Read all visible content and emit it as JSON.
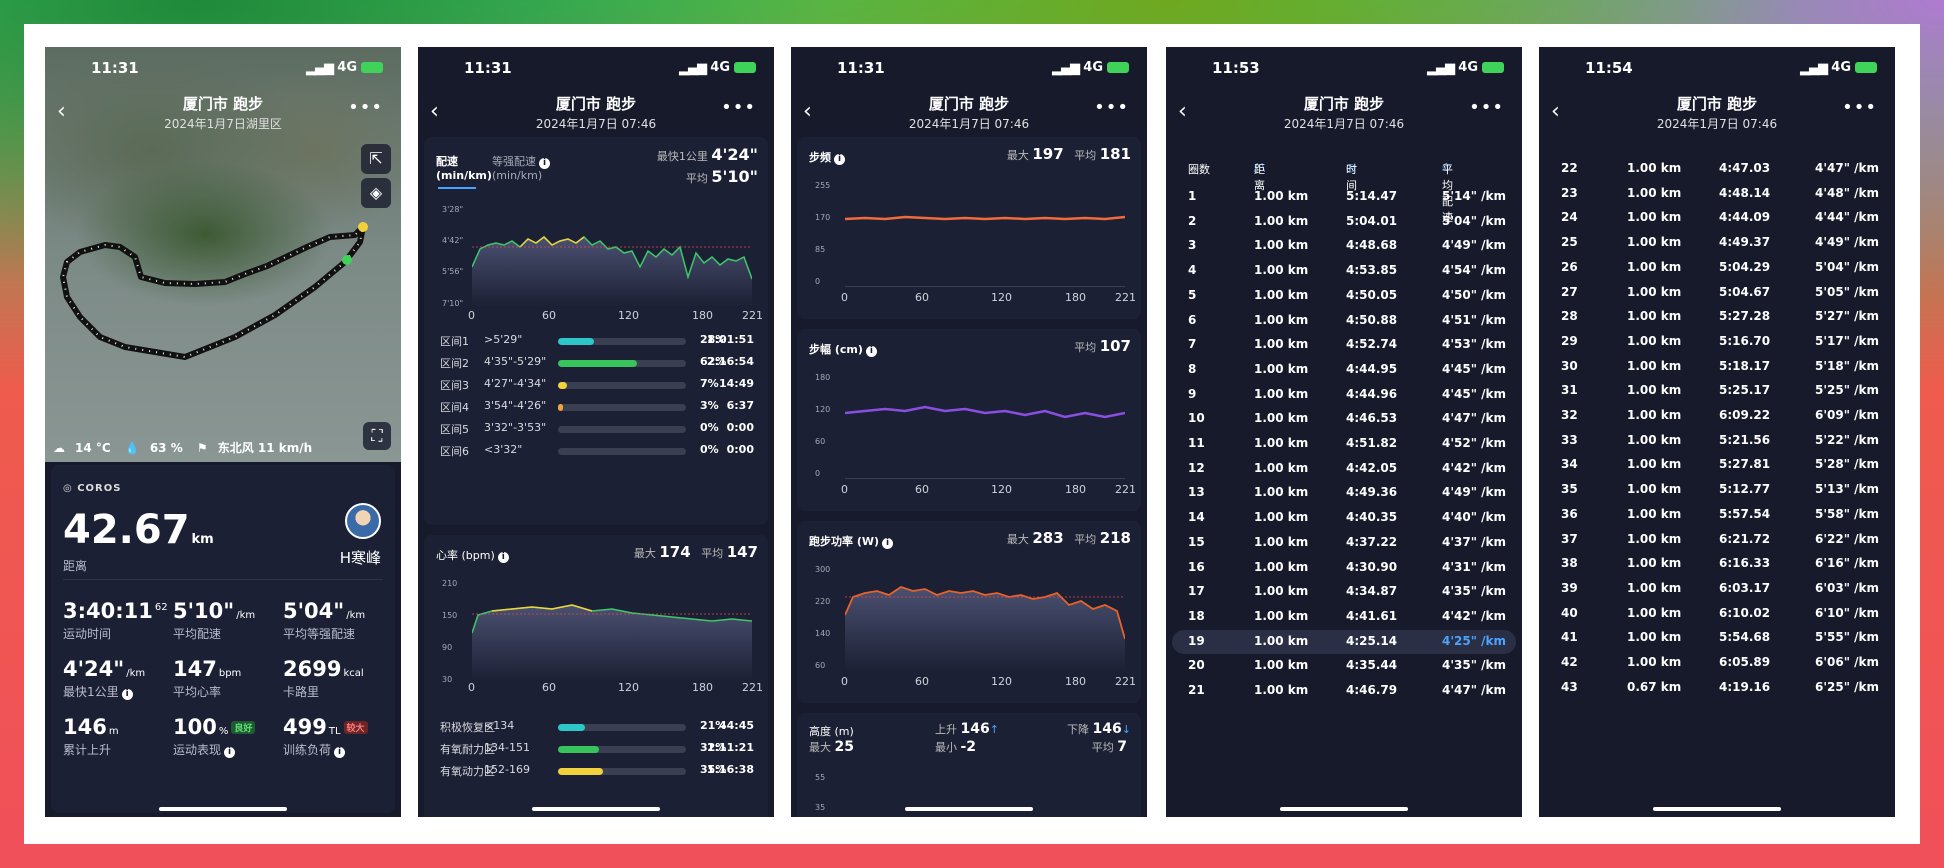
{
  "status": {
    "signal": "4G"
  },
  "nav": {
    "title": "厦门市 跑步",
    "subtitle": "2024年1月7日 07:46",
    "map_subtitle": "2024年1月7日湖里区"
  },
  "phones": {
    "map": {
      "time": "11:31",
      "weather": {
        "temp": "14 °C",
        "humidity": "63 %",
        "wind": "东北风 11 km/h"
      },
      "brand": "COROS",
      "distance": "42.67",
      "distance_unit": "km",
      "distance_label": "距离",
      "user": "H寒峰",
      "stats": [
        {
          "value": "3:40:11",
          "sup": "62",
          "label": "运动时间"
        },
        {
          "value": "5'10\"",
          "sup": "/km",
          "label": "平均配速"
        },
        {
          "value": "5'04\"",
          "sup": "/km",
          "label": "平均等强配速"
        },
        {
          "value": "4'24\"",
          "sup": "/km",
          "label": "最快1公里"
        },
        {
          "value": "147",
          "sup": "bpm",
          "label": "平均心率"
        },
        {
          "value": "2699",
          "sup": "kcal",
          "label": "卡路里"
        },
        {
          "value": "146",
          "sup": "m",
          "label": "累计上升"
        },
        {
          "value": "100",
          "sup": "%",
          "label": "运动表现",
          "tag": "良好"
        },
        {
          "value": "499",
          "sup": "TL",
          "label": "训练负荷",
          "tag": "较大"
        }
      ]
    },
    "pace": {
      "time": "11:31",
      "tab_pace": "配速",
      "tab_pace_unit": "(min/km)",
      "tab_gap": "等强配速",
      "tab_gap_unit": "(min/km)",
      "fastest_label": "最快1公里",
      "fastest": "4'24\"",
      "avg_label": "平均",
      "avg": "5'10\"",
      "y_ticks": [
        "3'28\"",
        "4'42\"",
        "5'56\"",
        "7'10\""
      ],
      "x_ticks": [
        "0",
        "60",
        "120",
        "180",
        "221"
      ],
      "zones": [
        {
          "name": "区间1",
          "range": ">5'29\"",
          "pct": "28%",
          "time": "1:01:51",
          "frac": 0.28,
          "color": "#2ec7c9"
        },
        {
          "name": "区间2",
          "range": "4'35\"-5'29\"",
          "pct": "62%",
          "time": "2:16:54",
          "frac": 0.62,
          "color": "#37c45a"
        },
        {
          "name": "区间3",
          "range": "4'27\"-4'34\"",
          "pct": "7%",
          "time": "14:49",
          "frac": 0.07,
          "color": "#f2d23c"
        },
        {
          "name": "区间4",
          "range": "3'54\"-4'26\"",
          "pct": "3%",
          "time": "6:37",
          "frac": 0.03,
          "color": "#f2a33c"
        },
        {
          "name": "区间5",
          "range": "3'32\"-3'53\"",
          "pct": "0%",
          "time": "0:00",
          "frac": 0,
          "color": "#f06a3c"
        },
        {
          "name": "区间6",
          "range": "<3'32\"",
          "pct": "0%",
          "time": "0:00",
          "frac": 0,
          "color": "#e03c3c"
        }
      ],
      "hr_title": "心率 (bpm)",
      "hr_max_label": "最大",
      "hr_max": "174",
      "hr_avg_label": "平均",
      "hr_avg": "147",
      "hr_y_ticks": [
        "210",
        "150",
        "90",
        "30"
      ],
      "hr_zones": [
        {
          "name": "积极恢复区",
          "range": "<134",
          "pct": "21%",
          "time": "44:45",
          "frac": 0.21,
          "color": "#2ec7c9"
        },
        {
          "name": "有氧耐力区",
          "range": "134-151",
          "pct": "32%",
          "time": "1:11:21",
          "frac": 0.32,
          "color": "#37c45a"
        },
        {
          "name": "有氧动力区",
          "range": "152-169",
          "pct": "35%",
          "time": "1:16:38",
          "frac": 0.35,
          "color": "#f2d23c"
        }
      ]
    },
    "dynamics": {
      "time": "11:31",
      "cadence_title": "步频",
      "cadence_max_label": "最大",
      "cadence_max": "197",
      "cadence_avg_label": "平均",
      "cadence_avg": "181",
      "cadence_y": [
        "255",
        "170",
        "85",
        "0"
      ],
      "stride_title": "步幅 (cm)",
      "stride_avg_label": "平均",
      "stride_avg": "107",
      "stride_y": [
        "180",
        "120",
        "60",
        "0"
      ],
      "power_title": "跑步功率 (W)",
      "power_max_label": "最大",
      "power_max": "283",
      "power_avg_label": "平均",
      "power_avg": "218",
      "power_y": [
        "300",
        "220",
        "140",
        "60"
      ],
      "x_ticks": [
        "0",
        "60",
        "120",
        "180",
        "221"
      ],
      "elev_title": "高度 (m)",
      "elev_up_label": "上升",
      "elev_up": "146",
      "elev_down_label": "下降",
      "elev_down": "146",
      "elev_max_label": "最大",
      "elev_max": "25",
      "elev_min_label": "最小",
      "elev_min": "-2",
      "elev_avg_label": "平均",
      "elev_avg": "7",
      "elev_y": [
        "55",
        "35"
      ]
    },
    "splits1": {
      "time": "11:53",
      "headers": [
        "圈数",
        "距离",
        "时间",
        "平均配速"
      ],
      "rows": [
        [
          "1",
          "1.00 km",
          "5:14.47",
          "5'14\" /km"
        ],
        [
          "2",
          "1.00 km",
          "5:04.01",
          "5'04\" /km"
        ],
        [
          "3",
          "1.00 km",
          "4:48.68",
          "4'49\" /km"
        ],
        [
          "4",
          "1.00 km",
          "4:53.85",
          "4'54\" /km"
        ],
        [
          "5",
          "1.00 km",
          "4:50.05",
          "4'50\" /km"
        ],
        [
          "6",
          "1.00 km",
          "4:50.88",
          "4'51\" /km"
        ],
        [
          "7",
          "1.00 km",
          "4:52.74",
          "4'53\" /km"
        ],
        [
          "8",
          "1.00 km",
          "4:44.95",
          "4'45\" /km"
        ],
        [
          "9",
          "1.00 km",
          "4:44.96",
          "4'45\" /km"
        ],
        [
          "10",
          "1.00 km",
          "4:46.53",
          "4'47\" /km"
        ],
        [
          "11",
          "1.00 km",
          "4:51.82",
          "4'52\" /km"
        ],
        [
          "12",
          "1.00 km",
          "4:42.05",
          "4'42\" /km"
        ],
        [
          "13",
          "1.00 km",
          "4:49.36",
          "4'49\" /km"
        ],
        [
          "14",
          "1.00 km",
          "4:40.35",
          "4'40\" /km"
        ],
        [
          "15",
          "1.00 km",
          "4:37.22",
          "4'37\" /km"
        ],
        [
          "16",
          "1.00 km",
          "4:30.90",
          "4'31\" /km"
        ],
        [
          "17",
          "1.00 km",
          "4:34.87",
          "4'35\" /km"
        ],
        [
          "18",
          "1.00 km",
          "4:41.61",
          "4'42\" /km"
        ],
        [
          "19",
          "1.00 km",
          "4:25.14",
          "4'25\" /km"
        ],
        [
          "20",
          "1.00 km",
          "4:35.44",
          "4'35\" /km"
        ],
        [
          "21",
          "1.00 km",
          "4:46.79",
          "4'47\" /km"
        ]
      ],
      "highlight_index": 18
    },
    "splits2": {
      "time": "11:54",
      "rows": [
        [
          "22",
          "1.00 km",
          "4:47.03",
          "4'47\" /km"
        ],
        [
          "23",
          "1.00 km",
          "4:48.14",
          "4'48\" /km"
        ],
        [
          "24",
          "1.00 km",
          "4:44.09",
          "4'44\" /km"
        ],
        [
          "25",
          "1.00 km",
          "4:49.37",
          "4'49\" /km"
        ],
        [
          "26",
          "1.00 km",
          "5:04.29",
          "5'04\" /km"
        ],
        [
          "27",
          "1.00 km",
          "5:04.67",
          "5'05\" /km"
        ],
        [
          "28",
          "1.00 km",
          "5:27.28",
          "5'27\" /km"
        ],
        [
          "29",
          "1.00 km",
          "5:16.70",
          "5'17\" /km"
        ],
        [
          "30",
          "1.00 km",
          "5:18.17",
          "5'18\" /km"
        ],
        [
          "31",
          "1.00 km",
          "5:25.17",
          "5'25\" /km"
        ],
        [
          "32",
          "1.00 km",
          "6:09.22",
          "6'09\" /km"
        ],
        [
          "33",
          "1.00 km",
          "5:21.56",
          "5'22\" /km"
        ],
        [
          "34",
          "1.00 km",
          "5:27.81",
          "5'28\" /km"
        ],
        [
          "35",
          "1.00 km",
          "5:12.77",
          "5'13\" /km"
        ],
        [
          "36",
          "1.00 km",
          "5:57.54",
          "5'58\" /km"
        ],
        [
          "37",
          "1.00 km",
          "6:21.72",
          "6'22\" /km"
        ],
        [
          "38",
          "1.00 km",
          "6:16.33",
          "6'16\" /km"
        ],
        [
          "39",
          "1.00 km",
          "6:03.17",
          "6'03\" /km"
        ],
        [
          "40",
          "1.00 km",
          "6:10.02",
          "6'10\" /km"
        ],
        [
          "41",
          "1.00 km",
          "5:54.68",
          "5'55\" /km"
        ],
        [
          "42",
          "1.00 km",
          "6:05.89",
          "6'06\" /km"
        ],
        [
          "43",
          "0.67 km",
          "4:19.16",
          "6'25\" /km"
        ]
      ]
    }
  },
  "colors": {
    "bg": "#161a2b",
    "card": "#1c2034",
    "cadence": "#f06a3c",
    "stride": "#8a4fe0",
    "power": "#e8622a",
    "accent": "#4aa3ff"
  }
}
